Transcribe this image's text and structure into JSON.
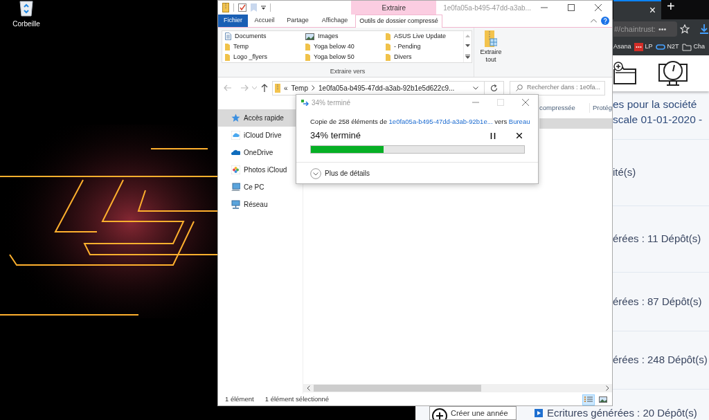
{
  "desktop": {
    "icons": [
      {
        "label": "Corbeille"
      }
    ]
  },
  "browser": {
    "tab_close": "×",
    "new_tab": "+",
    "address": "#/chaintrust:",
    "menu": "•••",
    "bookmarks": [
      {
        "label": "Asana",
        "kind": "plain"
      },
      {
        "label": "LP",
        "kind": "lastpass"
      },
      {
        "label": "N2T",
        "kind": "link"
      },
      {
        "label": "Cha",
        "kind": "folder"
      }
    ],
    "heading": [
      "es pour la société",
      "scale 01-01-2020 -"
    ],
    "rows": [
      "ité(s)",
      "érées : 11 Dépôt(s)",
      "érées : 87 Dépôt(s)",
      "érées : 248 Dépôt(s)"
    ],
    "create_button": "Créer une année",
    "footer_row": "Ecritures générées : 20 Dépôt(s)"
  },
  "explorer": {
    "title": "1e0fa05a-b495-47dd-a3ab...",
    "context_group": "Extraire",
    "ribbon_tabs": [
      {
        "label": "Fichier",
        "kind": "file",
        "selected": false
      },
      {
        "label": "Accueil",
        "kind": "tab",
        "selected": false
      },
      {
        "label": "Partage",
        "kind": "tab",
        "selected": false
      },
      {
        "label": "Affichage",
        "kind": "tab",
        "selected": false
      },
      {
        "label": "Outils de dossier compressé",
        "kind": "context",
        "selected": true
      }
    ],
    "extract_to": {
      "label": "Extraire vers",
      "items": [
        {
          "label": "Documents",
          "kind": "documents"
        },
        {
          "label": "Images",
          "kind": "pictures"
        },
        {
          "label": "ASUS Live Update",
          "kind": "folder"
        },
        {
          "label": "Temp",
          "kind": "folder"
        },
        {
          "label": "Yoga below 40",
          "kind": "folder"
        },
        {
          "label": "- Pending",
          "kind": "folder"
        },
        {
          "label": "Logo _flyers",
          "kind": "folder"
        },
        {
          "label": "Yoga below 50",
          "kind": "folder"
        },
        {
          "label": "Divers",
          "kind": "folder"
        }
      ]
    },
    "extract_all": "Extraire tout",
    "breadcrumb": {
      "overflow": "«",
      "parts": [
        "Temp",
        "1e0fa05a-b495-47dd-a3ab-92b1e5d622c9..."
      ]
    },
    "search": {
      "placeholder": "Rechercher dans : 1e0fa..."
    },
    "nav_pane": [
      {
        "label": "Accès rapide",
        "kind": "star",
        "selected": true
      },
      {
        "label": "iCloud Drive",
        "kind": "icloud",
        "selected": false
      },
      {
        "label": "OneDrive",
        "kind": "onedrive",
        "selected": false
      },
      {
        "label": "Photos iCloud",
        "kind": "photos",
        "selected": false
      },
      {
        "label": "Ce PC",
        "kind": "pc",
        "selected": false
      },
      {
        "label": "Réseau",
        "kind": "network",
        "selected": false
      }
    ],
    "columns": [
      "compressée",
      "Protég"
    ],
    "rows": [
      {
        "selected": true
      }
    ],
    "status": [
      "1 élément",
      "1 élément sélectionné"
    ]
  },
  "copy_dialog": {
    "title": "34% terminé",
    "message": {
      "prefix": "Copie de 258 éléments de",
      "source": "1e0fa05a-b495-47dd-a3ab-92b1e...",
      "middle": "vers",
      "destination": "Bureau"
    },
    "progress_text": "34% terminé",
    "level": 0.34,
    "details": "Plus de détails"
  }
}
